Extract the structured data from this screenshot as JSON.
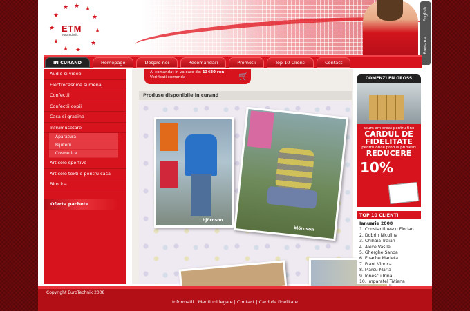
{
  "header": {
    "logo_text": "ETM",
    "logo_sub": "eurotechnik",
    "lang": [
      "Romana",
      "English"
    ]
  },
  "nav": {
    "tabs": [
      "IN CURAND",
      "Homepage",
      "Despre noi",
      "Recomandari",
      "Promotii",
      "Top 10 Clienti",
      "Contact"
    ]
  },
  "sidebar": {
    "items": [
      "Audio si video",
      "Electrocasnice si menaj",
      "Confectii",
      "Confectii copii",
      "Casa si gradina",
      "Infrumusetare"
    ],
    "sub_items": [
      "Aparatura",
      "Bijuterii",
      "Cosmetice"
    ],
    "items_after": [
      "Articole sportive",
      "Articole textile pentru casa",
      "Birotica"
    ],
    "offer": "Oferta pachete"
  },
  "cart": {
    "text": "Ai comandat in valoare de:",
    "value": "13480 ron",
    "link": "Verificati comanda"
  },
  "content": {
    "title": "Produse disponibile in curand",
    "brand": "björnson"
  },
  "right": {
    "bulk_title": "COMENZI EN GROSS",
    "card_line1": "acum am creat pentru tine",
    "card_big1": "CARDUL DE",
    "card_big2": "FIDELITATE",
    "card_line2": "pentru orice produs primesti",
    "card_big3": "REDUCERE",
    "card_pct": "10%",
    "top_title": "TOP 10 CLIENTI",
    "top_month": "Ianuarie 2008",
    "top_list": [
      "1. Constantinescu Florian",
      "2. Dobrin Niculina",
      "3. Chihaia Traian",
      "4. Alexe Vasile",
      "5. Gherghe Sanda",
      "6. Enache Marieta",
      "7. Frant Viorica",
      "8. Marcu Maria",
      "9. Ionescu Irina",
      "10. Imparatel Tatiana"
    ]
  },
  "footer": {
    "copyright": "Copyright EuroTechnik 2008",
    "links": "Informatii | Mentiuni legale | Contact | Card de fidelitate"
  },
  "colors": {
    "primary_red": "#d7141d",
    "dark_red": "#b20f17",
    "background": "#6e0a0c"
  }
}
